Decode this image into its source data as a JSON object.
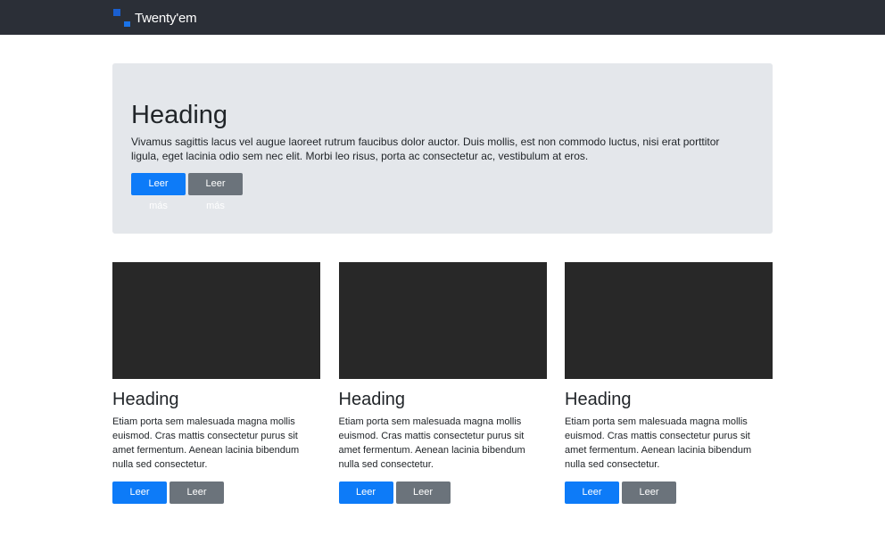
{
  "navbar": {
    "brand_name": "Twenty'em",
    "logo_colors": [
      "#1a5fd0",
      "#1a73e8"
    ],
    "background": "#2b2f37"
  },
  "jumbotron": {
    "title": "Heading",
    "text": "Vivamus sagittis lacus vel augue laoreet rutrum faucibus dolor auctor. Duis mollis, est non commodo luctus, nisi erat porttitor ligula, eget lacinia odio sem nec elit. Morbi leo risus, porta ac consectetur ac, vestibulum at eros.",
    "primary_label": "Leer más",
    "secondary_label": "Leer más"
  },
  "cards": [
    {
      "title": "Heading",
      "text": "Etiam porta sem malesuada magna mollis euismod. Cras mattis consectetur purus sit amet fermentum. Aenean lacinia bibendum nulla sed consectetur.",
      "primary_label": "Leer más",
      "secondary_label": "Leer más"
    },
    {
      "title": "Heading",
      "text": "Etiam porta sem malesuada magna mollis euismod. Cras mattis consectetur purus sit amet fermentum. Aenean lacinia bibendum nulla sed consectetur.",
      "primary_label": "Leer más",
      "secondary_label": "Leer más"
    },
    {
      "title": "Heading",
      "text": "Etiam porta sem malesuada magna mollis euismod. Cras mattis consectetur purus sit amet fermentum. Aenean lacinia bibendum nulla sed consectetur.",
      "primary_label": "Leer más",
      "secondary_label": "Leer más"
    }
  ],
  "colors": {
    "primary": "#0d7bf8",
    "secondary": "#6b737b",
    "jumbotron_bg": "#e4e7eb",
    "card_image_bg": "#282828"
  }
}
